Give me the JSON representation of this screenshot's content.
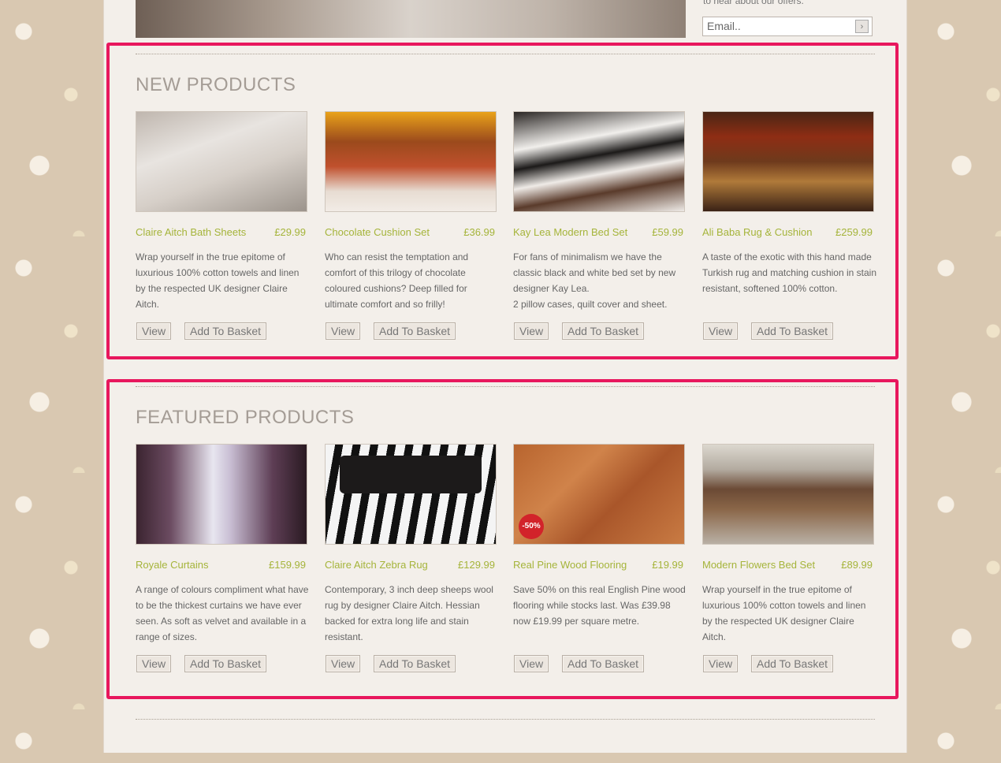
{
  "header": {
    "offer_text": "to hear about our offers.",
    "email_placeholder": "Email..",
    "email_go": "›"
  },
  "new_products": {
    "title": "NEW PRODUCTS",
    "items": [
      {
        "name": "Claire Aitch Bath Sheets",
        "price": "£29.99",
        "description": "Wrap yourself in the true epitome of luxurious 100% cotton towels and linen by the respected UK designer Claire Aitch.",
        "view": "View",
        "add": "Add To Basket"
      },
      {
        "name": "Chocolate Cushion Set",
        "price": "£36.99",
        "description": "Who can resist the temptation and comfort of this trilogy of chocolate coloured cushions? Deep filled for ultimate comfort and so frilly!",
        "view": "View",
        "add": "Add To Basket"
      },
      {
        "name": "Kay Lea Modern Bed Set",
        "price": "£59.99",
        "description": "For fans of minimalism we have the classic black and white bed set by new designer Kay Lea.\n2 pillow cases, quilt cover and sheet.",
        "view": "View",
        "add": "Add To Basket"
      },
      {
        "name": "Ali Baba Rug & Cushion",
        "price": "£259.99",
        "description": "A  taste of the exotic with this hand made Turkish rug and matching cushion in stain resistant, softened 100% cotton.",
        "view": "View",
        "add": "Add To Basket"
      }
    ]
  },
  "featured_products": {
    "title": "FEATURED PRODUCTS",
    "items": [
      {
        "name": "Royale Curtains",
        "price": "£159.99",
        "description": "A range of colours compliment what have to be the thickest curtains we have ever seen. As soft as velvet and available in a range of sizes.",
        "view": "View",
        "add": "Add To Basket"
      },
      {
        "name": "Claire Aitch Zebra Rug",
        "price": "£129.99",
        "description": "Contemporary, 3 inch deep sheeps wool rug by designer Claire Aitch. Hessian backed for extra long life and stain resistant.",
        "view": "View",
        "add": "Add To Basket"
      },
      {
        "name": "Real Pine Wood Flooring",
        "price": "£19.99",
        "description": "Save 50% on this real English Pine wood flooring while stocks last. Was £39.98 now £19.99 per square metre.",
        "view": "View",
        "add": "Add To Basket",
        "badge": "-50%"
      },
      {
        "name": "Modern Flowers Bed Set",
        "price": "£89.99",
        "description": "Wrap yourself in the true epitome of luxurious 100% cotton towels and linen by the respected UK designer Claire Aitch.",
        "view": "View",
        "add": "Add To Basket"
      }
    ]
  },
  "colors": {
    "highlight": "#e8175d",
    "product_name": "#a5b43a",
    "page_background": "#f3efea"
  }
}
